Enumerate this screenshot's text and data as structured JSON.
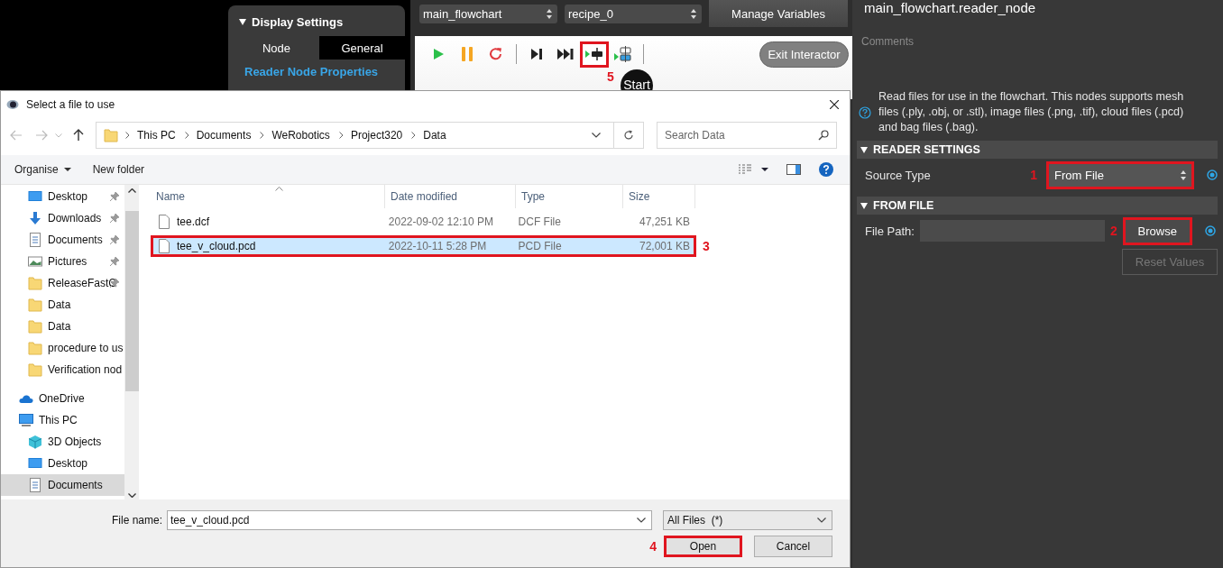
{
  "display_settings": {
    "title": "Display Settings",
    "expanded": true,
    "tabs": [
      {
        "label": "Node",
        "selected": false
      },
      {
        "label": "General",
        "selected": true
      }
    ],
    "link": "Reader Node Properties"
  },
  "flowchart_bar": {
    "flowchart_select": "main_flowchart",
    "recipe_select": "recipe_0",
    "manage_button": "Manage Variables"
  },
  "toolbar": {
    "buttons": [
      {
        "kind": "play",
        "highlighted": false
      },
      {
        "kind": "pause",
        "highlighted": false
      },
      {
        "kind": "reload",
        "highlighted": false
      },
      {
        "kind": "separator"
      },
      {
        "kind": "step",
        "highlighted": false
      },
      {
        "kind": "fast_forward",
        "highlighted": false
      },
      {
        "kind": "run_to_node",
        "highlighted": true,
        "callout": "5"
      },
      {
        "kind": "run_node",
        "highlighted": false
      },
      {
        "kind": "separator"
      }
    ],
    "exit_button": "Exit Interactor"
  },
  "canvas": {
    "start_node": "Start"
  },
  "properties": {
    "title": "main_flowchart.reader_node",
    "comments_label": "Comments",
    "description": "Read files for use in the flowchart. This nodes supports mesh files (.ply, .obj, or .stl), image files (.png, .tif), cloud files (.pcd) and bag files (.bag).",
    "sections": [
      {
        "title": "READER SETTINGS",
        "expanded": true,
        "rows": [
          {
            "kind": "select",
            "label": "Source Type",
            "value": "From File",
            "highlighted": true,
            "callout": "1"
          }
        ]
      },
      {
        "title": "FROM FILE",
        "expanded": true,
        "rows": [
          {
            "kind": "file",
            "label": "File Path:",
            "button": "Browse",
            "highlighted": true,
            "callout": "2"
          }
        ]
      }
    ],
    "reset_button": "Reset Values"
  },
  "dialog": {
    "title": "Select a file to use",
    "breadcrumbs": [
      "This PC",
      "Documents",
      "WeRobotics",
      "Project320",
      "Data"
    ],
    "search": {
      "placeholder": "Search Data"
    },
    "commands": {
      "organise": "Organise",
      "new_folder": "New folder"
    },
    "nav_pane": {
      "quick_access": [
        {
          "label": "Desktop",
          "kind": "desktop",
          "pinned": true,
          "selected": false
        },
        {
          "label": "Downloads",
          "kind": "downloads",
          "pinned": true,
          "selected": false
        },
        {
          "label": "Documents",
          "kind": "documents",
          "pinned": true,
          "selected": false
        },
        {
          "label": "Pictures",
          "kind": "pictures",
          "pinned": true,
          "selected": false
        },
        {
          "label": "ReleaseFastC",
          "kind": "folder",
          "pinned": true,
          "selected": false
        },
        {
          "label": "Data",
          "kind": "folder",
          "pinned": false,
          "selected": false
        },
        {
          "label": "Data",
          "kind": "folder",
          "pinned": false,
          "selected": false
        },
        {
          "label": "procedure to us",
          "kind": "folder",
          "pinned": false,
          "selected": false
        },
        {
          "label": "Verification nod",
          "kind": "folder",
          "pinned": false,
          "selected": false
        }
      ],
      "locations": [
        {
          "label": "OneDrive",
          "kind": "cloud",
          "selected": false
        },
        {
          "label": "This PC",
          "kind": "computer",
          "selected": false,
          "children": [
            {
              "label": "3D Objects",
              "kind": "cube",
              "selected": false
            },
            {
              "label": "Desktop",
              "kind": "desktop",
              "selected": false
            },
            {
              "label": "Documents",
              "kind": "documents",
              "selected": true
            }
          ]
        }
      ]
    },
    "columns": [
      "Name",
      "Date modified",
      "Type",
      "Size"
    ],
    "files": [
      {
        "name": "tee.dcf",
        "date_modified": "2022-09-02 12:10 PM",
        "type": "DCF File",
        "size": "47,251 KB",
        "selected": false,
        "highlighted": false
      },
      {
        "name": "tee_v_cloud.pcd",
        "date_modified": "2022-10-11 5:28 PM",
        "type": "PCD File",
        "size": "72,001 KB",
        "selected": true,
        "highlighted": true,
        "callout": "3"
      }
    ],
    "file_name": {
      "label": "File name:",
      "value": "tee_v_cloud.pcd"
    },
    "file_type": "All Files  (*)",
    "buttons": [
      {
        "label": "Open",
        "highlighted": true,
        "callout": "4"
      },
      {
        "label": "Cancel",
        "highlighted": false
      }
    ]
  }
}
